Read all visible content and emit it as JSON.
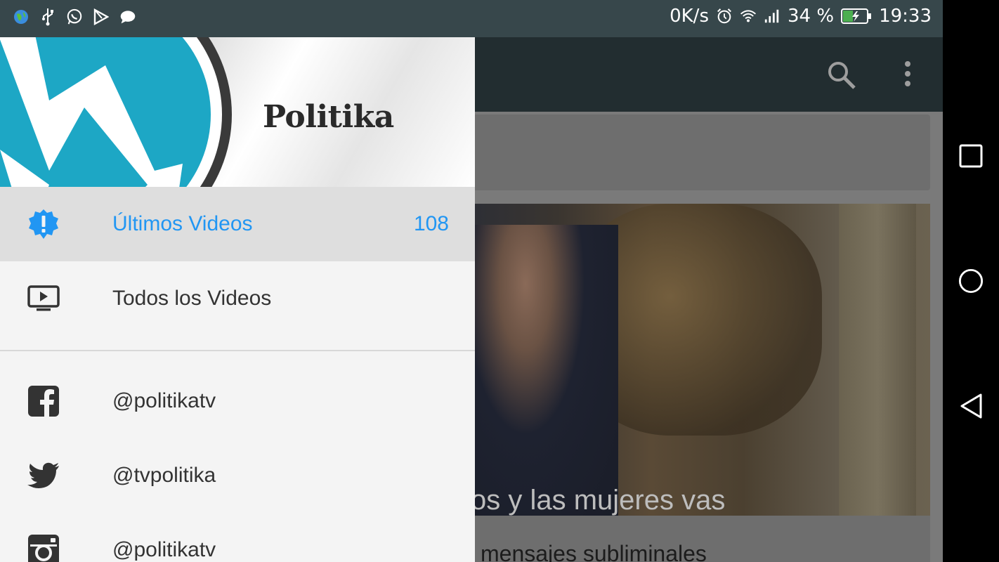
{
  "status_bar": {
    "net_speed": "0K/s",
    "battery_percent": "34 %",
    "time": "19:33",
    "icons_left": [
      "globe-icon",
      "usb-icon",
      "whatsapp-icon",
      "play-store-icon",
      "message-icon"
    ],
    "icons_right": [
      "alarm-icon",
      "wifi-icon",
      "signal-icon",
      "battery-charging-icon"
    ]
  },
  "drawer": {
    "brand": "Politika",
    "items": [
      {
        "label": "Últimos Videos",
        "count": "108",
        "icon": "new-badge-icon",
        "active": true
      },
      {
        "label": "Todos los Videos",
        "icon": "tv-play-icon"
      },
      {
        "label": "@politikatv",
        "icon": "facebook-icon"
      },
      {
        "label": "@tvpolitika",
        "icon": "twitter-icon"
      },
      {
        "label": "@politikatv",
        "icon": "instagram-icon"
      }
    ]
  },
  "main": {
    "video_subtitle": "os y las mujeres vas",
    "video_title": "mensajes subliminales"
  },
  "colors": {
    "accent": "#2196f3",
    "status_bar": "#37474b",
    "app_bar": "#222d30"
  }
}
